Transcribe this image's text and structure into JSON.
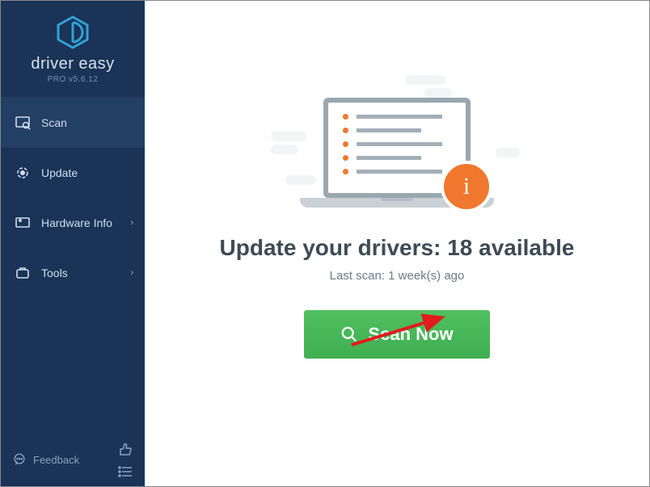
{
  "brand": {
    "name": "driver easy",
    "version": "PRO v5.6.12"
  },
  "sidebar": {
    "items": [
      {
        "label": "Scan",
        "has_chevron": false
      },
      {
        "label": "Update",
        "has_chevron": false
      },
      {
        "label": "Hardware Info",
        "has_chevron": true
      },
      {
        "label": "Tools",
        "has_chevron": true
      }
    ],
    "feedback_label": "Feedback"
  },
  "main": {
    "headline_prefix": "Update your drivers: ",
    "headline_count": "18",
    "headline_suffix": " available",
    "last_scan": "Last scan: 1 week(s) ago",
    "scan_button": "Scan Now"
  },
  "colors": {
    "accent_orange": "#f0772e",
    "accent_green": "#4fc060",
    "sidebar_bg": "#1a3356"
  }
}
